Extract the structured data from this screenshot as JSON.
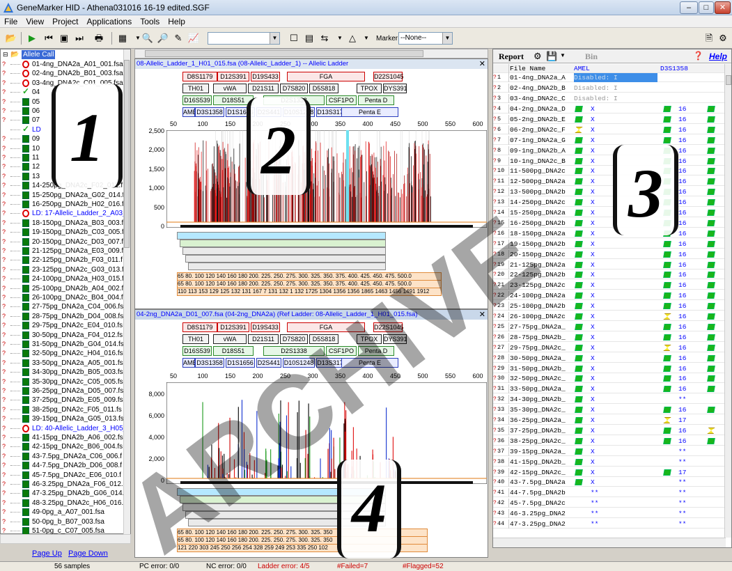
{
  "window": {
    "title": "GeneMarker HID - Athena031016 16-19 edited.SGF",
    "min": "–",
    "max": "□",
    "close": "✕"
  },
  "menu": [
    "File",
    "View",
    "Project",
    "Applications",
    "Tools",
    "Help"
  ],
  "toolbar": {
    "marker_label": "Marker:",
    "marker_value": "--None--"
  },
  "tree": {
    "root": "Allele Call",
    "items": [
      {
        "q": "?",
        "icon": "ban",
        "label": "01-4ng_DNA2a_A01_001.fsa"
      },
      {
        "q": "?",
        "icon": "ban",
        "label": "02-4ng_DNA2b_B01_003.fsa"
      },
      {
        "q": "?",
        "icon": "ban",
        "label": "03-4ng_DNA2c_C01_005.fsa"
      },
      {
        "q": "?",
        "icon": "chk",
        "label": "04"
      },
      {
        "q": "?",
        "icon": "doc",
        "label": "05"
      },
      {
        "q": "?",
        "icon": "doc",
        "label": "06"
      },
      {
        "q": "?",
        "icon": "doc",
        "label": "07"
      },
      {
        "q": "",
        "icon": "chk",
        "label": "LD",
        "ladder": true
      },
      {
        "q": "?",
        "icon": "doc",
        "label": "09"
      },
      {
        "q": "?",
        "icon": "doc",
        "label": "10"
      },
      {
        "q": "?",
        "icon": "doc",
        "label": "11"
      },
      {
        "q": "?",
        "icon": "doc",
        "label": "12"
      },
      {
        "q": "?",
        "icon": "doc",
        "label": "13"
      },
      {
        "q": "?",
        "icon": "doc",
        "label": "14-250pg_DNA2c_F02_012.f"
      },
      {
        "q": "?",
        "icon": "doc",
        "label": "15-250pg_DNA2a_G02_014.f"
      },
      {
        "q": "?",
        "icon": "doc",
        "label": "16-250pg_DNA2b_H02_016.f"
      },
      {
        "q": "?",
        "icon": "ban",
        "label": "LD: 17-Allelic_Ladder_2_A03_",
        "ladder": true
      },
      {
        "q": "?",
        "icon": "doc",
        "label": "18-150pg_DNA2a_B03_003.f"
      },
      {
        "q": "?",
        "icon": "doc",
        "label": "19-150pg_DNA2b_C03_005.f"
      },
      {
        "q": "?",
        "icon": "doc",
        "label": "20-150pg_DNA2c_D03_007.f"
      },
      {
        "q": "?",
        "icon": "doc",
        "label": "21-125pg_DNA2a_E03_009.f"
      },
      {
        "q": "?",
        "icon": "doc",
        "label": "22-125pg_DNA2b_F03_011.f"
      },
      {
        "q": "?",
        "icon": "doc",
        "label": "23-125pg_DNA2c_G03_013.f"
      },
      {
        "q": "?",
        "icon": "doc",
        "label": "24-100pg_DNA2a_H03_015.f"
      },
      {
        "q": "?",
        "icon": "doc",
        "label": "25-100pg_DNA2b_A04_002.f"
      },
      {
        "q": "?",
        "icon": "doc",
        "label": "26-100pg_DNA2c_B04_004.f"
      },
      {
        "q": "?",
        "icon": "doc",
        "label": "27-75pg_DNA2a_C04_006.fs"
      },
      {
        "q": "?",
        "icon": "doc",
        "label": "28-75pg_DNA2b_D04_008.fs"
      },
      {
        "q": "?",
        "icon": "doc",
        "label": "29-75pg_DNA2c_E04_010.fs"
      },
      {
        "q": "?",
        "icon": "doc",
        "label": "30-50pg_DNA2a_F04_012.fs"
      },
      {
        "q": "?",
        "icon": "doc",
        "label": "31-50pg_DNA2b_G04_014.fs"
      },
      {
        "q": "?",
        "icon": "doc",
        "label": "32-50pg_DNA2c_H04_016.fs"
      },
      {
        "q": "?",
        "icon": "doc",
        "label": "33-50pg_DNA2a_A05_001.fs"
      },
      {
        "q": "?",
        "icon": "doc",
        "label": "34-30pg_DNA2b_B05_003.fs"
      },
      {
        "q": "?",
        "icon": "doc",
        "label": "35-30pg_DNA2c_C05_005.fs"
      },
      {
        "q": "?",
        "icon": "doc",
        "label": "36-25pg_DNA2a_D05_007.fs"
      },
      {
        "q": "?",
        "icon": "doc",
        "label": "37-25pg_DNA2b_E05_009.fs"
      },
      {
        "q": "?",
        "icon": "doc",
        "label": "38-25pg_DNA2c_F05_011.fs"
      },
      {
        "q": "?",
        "icon": "doc",
        "label": "39-15pg_DNA2a_G05_013.fs"
      },
      {
        "q": "?",
        "icon": "ban",
        "label": "LD: 40-Allelic_Ladder_3_H05_",
        "ladder": true
      },
      {
        "q": "?",
        "icon": "doc",
        "label": "41-15pg_DNA2b_A06_002.fs"
      },
      {
        "q": "?",
        "icon": "doc",
        "label": "42-15pg_DNA2c_B06_004.fs"
      },
      {
        "q": "?",
        "icon": "doc",
        "label": "43-7.5pg_DNA2a_C06_006.f"
      },
      {
        "q": "?",
        "icon": "doc",
        "label": "44-7.5pg_DNA2b_D06_008.f"
      },
      {
        "q": "?",
        "icon": "doc",
        "label": "45-7.5pg_DNA2c_E06_010.f"
      },
      {
        "q": "?",
        "icon": "doc",
        "label": "46-3.25pg_DNA2a_F06_012."
      },
      {
        "q": "?",
        "icon": "doc",
        "label": "47-3.25pg_DNA2b_G06_014."
      },
      {
        "q": "?",
        "icon": "doc",
        "label": "48-3.25pg_DNA2c_H06_016."
      },
      {
        "q": "?",
        "icon": "doc",
        "label": "49-0pg_a_A07_001.fsa"
      },
      {
        "q": "?",
        "icon": "doc",
        "label": "50-0pg_b_B07_003.fsa"
      },
      {
        "q": "?",
        "icon": "doc",
        "label": "51-0pg_c_C07_005.fsa"
      },
      {
        "q": "?",
        "icon": "doc",
        "label": "52-Amp_Pos_a_D07_007.fsa"
      }
    ],
    "page_up": "Page Up",
    "page_down": "Page Down"
  },
  "panel_top": {
    "header": "08-Allelic_Ladder_1_H01_015.fsa  (08-Allelic_Ladder_1) -- Allelic Ladder",
    "y_ticks": [
      "2,500",
      "2,000",
      "1,500",
      "1,000",
      "500",
      "0"
    ],
    "x_ticks": [
      "50",
      "100",
      "150",
      "200",
      "250",
      "300",
      "350",
      "400",
      "450",
      "500",
      "550",
      "600"
    ]
  },
  "panel_bottom": {
    "header": "04-2ng_DNA2a_D01_007.fsa  (04-2ng_DNA2a)  (Ref Ladder: 08-Allelic_Ladder_1_H01_015.fsa)",
    "y_ticks": [
      "8,000",
      "6,000",
      "4,000",
      "2,000",
      "0"
    ],
    "x_ticks": [
      "50",
      "100",
      "150",
      "200",
      "250",
      "300",
      "350",
      "400",
      "450",
      "500",
      "550",
      "600"
    ]
  },
  "markers": {
    "row1": [
      [
        "D8S1179",
        "r"
      ],
      [
        "D12S391",
        "r"
      ],
      [
        "D19S433",
        "r"
      ],
      [
        "FGA",
        "r"
      ],
      [
        "D22S1045",
        "r"
      ]
    ],
    "row2": [
      [
        "TH01",
        "k"
      ],
      [
        "vWA",
        "k"
      ],
      [
        "D21S11",
        "k"
      ],
      [
        "D7S820",
        "k"
      ],
      [
        "D5S818",
        "k"
      ],
      [
        "TPOX",
        "k"
      ],
      [
        "DYS391",
        "k"
      ]
    ],
    "row3": [
      [
        "D16S539",
        "g"
      ],
      [
        "D18S51",
        "g"
      ],
      [
        "D2S1338",
        "g"
      ],
      [
        "CSF1PO",
        "g"
      ],
      [
        "Penta D",
        "g"
      ]
    ],
    "row4": [
      [
        "AMEL",
        "b"
      ],
      [
        "D3S1358",
        "b"
      ],
      [
        "D1S1656",
        "b"
      ],
      [
        "D2S441",
        "b"
      ],
      [
        "D10S1248",
        "b"
      ],
      [
        "D13S317",
        "b"
      ],
      [
        "Penta E",
        "b"
      ]
    ]
  },
  "bins_top": {
    "red": "65 80. 100 120 140 160 180 200. 225. 250. 275. 300. 325. 350. 375. 400. 425. 450. 475. 500.0",
    "red2": "65 80. 100 120 140 160 180 200. 225. 250. 275. 300. 325. 350. 375. 400. 425. 450. 475. 500.0",
    "sizes": "110 113 153 129 125 132 131 167 7 131 132 1 132 1725 1304 1356 1356 1865 1463 1456 1491 1912"
  },
  "bins_bottom": {
    "red": "65 80. 100 120 140 160 180 200. 225. 250. 275. 300. 325. 350",
    "red2": "65 80. 100 120 140 160 180 200. 225. 250. 275. 300. 325. 350",
    "sizes": "121 220 303 245 250 256 254 328 259 249 253 335 250 102"
  },
  "report": {
    "title": "Report",
    "bin": "Bin",
    "help": "Help",
    "columns": [
      "File Name",
      "AMEL",
      "",
      "D3S1358",
      "",
      ""
    ],
    "rows": [
      {
        "n": "?",
        "i": "1",
        "f": "01-4ng_DNA2a_A",
        "a": "Disabled: I",
        "d": "",
        "v": "",
        "hl": true
      },
      {
        "n": "?",
        "i": "2",
        "f": "02-4ng_DNA2b_B",
        "a": "Disabled: I",
        "d": "",
        "v": ""
      },
      {
        "n": "?",
        "i": "3",
        "f": "03-4ng_DNA2c_C",
        "a": "Disabled: I",
        "d": "",
        "v": ""
      },
      {
        "n": "?",
        "i": "4",
        "f": "04-2ng_DNA2a_D",
        "a": "X",
        "d": "16",
        "v": "g"
      },
      {
        "n": "?",
        "i": "5",
        "f": "05-2ng_DNA2b_E",
        "a": "X",
        "d": "16",
        "v": "g"
      },
      {
        "n": "?",
        "i": "6",
        "f": "06-2ng_DNA2c_F",
        "a": "X",
        "d": "16",
        "v": "g",
        "y": true
      },
      {
        "n": "?",
        "i": "7",
        "f": "07-1ng_DNA2a_G",
        "a": "X",
        "d": "16",
        "v": "g"
      },
      {
        "n": "?",
        "i": "8",
        "f": "09-1ng_DNA2b_A",
        "a": "X",
        "d": "16",
        "v": "g"
      },
      {
        "n": "?",
        "i": "9",
        "f": "10-1ng_DNA2c_B",
        "a": "X",
        "d": "16",
        "v": "g"
      },
      {
        "n": "?",
        "i": "10",
        "f": "11-500pg_DNA2c",
        "a": "X",
        "d": "16",
        "v": "g"
      },
      {
        "n": "?",
        "i": "11",
        "f": "12-500pg_DNA2a",
        "a": "X",
        "d": "16",
        "v": "g"
      },
      {
        "n": "?",
        "i": "12",
        "f": "13-500pg_DNA2b",
        "a": "X",
        "d": "16",
        "v": "g"
      },
      {
        "n": "?",
        "i": "13",
        "f": "14-250pg_DNA2c",
        "a": "X",
        "d": "16",
        "v": "g"
      },
      {
        "n": "?",
        "i": "14",
        "f": "15-250pg_DNA2a",
        "a": "X",
        "d": "16",
        "v": "g"
      },
      {
        "n": "?",
        "i": "15",
        "f": "16-250pg_DNA2b",
        "a": "X",
        "d": "16",
        "v": "g"
      },
      {
        "n": "?",
        "i": "16",
        "f": "18-150pg_DNA2a",
        "a": "X",
        "d": "16",
        "v": "g"
      },
      {
        "n": "?",
        "i": "17",
        "f": "19-150pg_DNA2b",
        "a": "X",
        "d": "16",
        "v": "g"
      },
      {
        "n": "?",
        "i": "18",
        "f": "20-150pg_DNA2c",
        "a": "X",
        "d": "16",
        "v": "g"
      },
      {
        "n": "?",
        "i": "19",
        "f": "21-125pg_DNA2a",
        "a": "X",
        "d": "16",
        "v": "g"
      },
      {
        "n": "?",
        "i": "20",
        "f": "22-125pg_DNA2b",
        "a": "X",
        "d": "16",
        "v": "g"
      },
      {
        "n": "?",
        "i": "21",
        "f": "23-125pg_DNA2c",
        "a": "X",
        "d": "16",
        "v": "g"
      },
      {
        "n": "?",
        "i": "22",
        "f": "24-100pg_DNA2a",
        "a": "X",
        "d": "16",
        "v": "g"
      },
      {
        "n": "?",
        "i": "23",
        "f": "25-100pg_DNA2b",
        "a": "X",
        "d": "16",
        "v": "g"
      },
      {
        "n": "?",
        "i": "24",
        "f": "26-100pg_DNA2c",
        "a": "X",
        "d": "16",
        "v": "g",
        "dy": true
      },
      {
        "n": "?",
        "i": "25",
        "f": "27-75pg_DNA2a_",
        "a": "X",
        "d": "16",
        "v": "g"
      },
      {
        "n": "?",
        "i": "26",
        "f": "28-75pg_DNA2b_",
        "a": "X",
        "d": "16",
        "v": "g"
      },
      {
        "n": "?",
        "i": "27",
        "f": "29-75pg_DNA2c_",
        "a": "X",
        "d": "16",
        "v": "g",
        "dy": true
      },
      {
        "n": "?",
        "i": "28",
        "f": "30-50pg_DNA2a_",
        "a": "X",
        "d": "16",
        "v": "g"
      },
      {
        "n": "?",
        "i": "29",
        "f": "31-50pg_DNA2b_",
        "a": "X",
        "d": "16",
        "v": "g"
      },
      {
        "n": "?",
        "i": "30",
        "f": "32-50pg_DNA2c_",
        "a": "X",
        "d": "16",
        "v": "g"
      },
      {
        "n": "?",
        "i": "31",
        "f": "33-50pg_DNA2a_",
        "a": "X",
        "d": "16",
        "v": "g"
      },
      {
        "n": "?",
        "i": "32",
        "f": "34-30pg_DNA2b_",
        "a": "X",
        "d": "**",
        "v": "",
        "nd": true
      },
      {
        "n": "?",
        "i": "33",
        "f": "35-30pg_DNA2c_",
        "a": "X",
        "d": "16",
        "v": "g"
      },
      {
        "n": "?",
        "i": "34",
        "f": "36-25pg_DNA2a_",
        "a": "X",
        "d": "17",
        "v": "",
        "dy": true
      },
      {
        "n": "?",
        "i": "35",
        "f": "37-25pg_DNA2b_",
        "a": "X",
        "d": "16",
        "v": "y"
      },
      {
        "n": "?",
        "i": "36",
        "f": "38-25pg_DNA2c_",
        "a": "X",
        "d": "16",
        "v": "g"
      },
      {
        "n": "?",
        "i": "37",
        "f": "39-15pg_DNA2a_",
        "a": "X",
        "d": "**",
        "v": "",
        "nd": true
      },
      {
        "n": "?",
        "i": "38",
        "f": "41-15pg_DNA2b_",
        "a": "X",
        "d": "**",
        "v": "",
        "nd": true
      },
      {
        "n": "?",
        "i": "39",
        "f": "42-15pg_DNA2c_",
        "a": "X",
        "d": "17",
        "v": ""
      },
      {
        "n": "?",
        "i": "40",
        "f": "43-7.5pg_DNA2a",
        "a": "X",
        "d": "**",
        "v": "",
        "nd": true
      },
      {
        "n": "?",
        "i": "41",
        "f": "44-7.5pg_DNA2b",
        "a": "**",
        "d": "**",
        "v": "",
        "na": true,
        "nd": true
      },
      {
        "n": "?",
        "i": "42",
        "f": "45-7.5pg_DNA2c",
        "a": "**",
        "d": "**",
        "v": "",
        "na": true,
        "nd": true
      },
      {
        "n": "?",
        "i": "43",
        "f": "46-3.25pg_DNA2",
        "a": "**",
        "d": "**",
        "v": "",
        "na": true,
        "nd": true
      },
      {
        "n": "?",
        "i": "44",
        "f": "47-3.25pg_DNA2",
        "a": "**",
        "d": "**",
        "v": "",
        "na": true,
        "nd": true
      }
    ]
  },
  "status": {
    "samples": "56 samples",
    "pc": "PC error: 0/0",
    "nc": "NC error: 0/0",
    "ladder": "Ladder error: 4/5",
    "failed": "#Failed=7",
    "flagged": "#Flagged=52"
  },
  "overlays": {
    "n1": "1",
    "n2": "2",
    "n3": "3",
    "n4": "4",
    "watermark": "ARCHIVE"
  }
}
